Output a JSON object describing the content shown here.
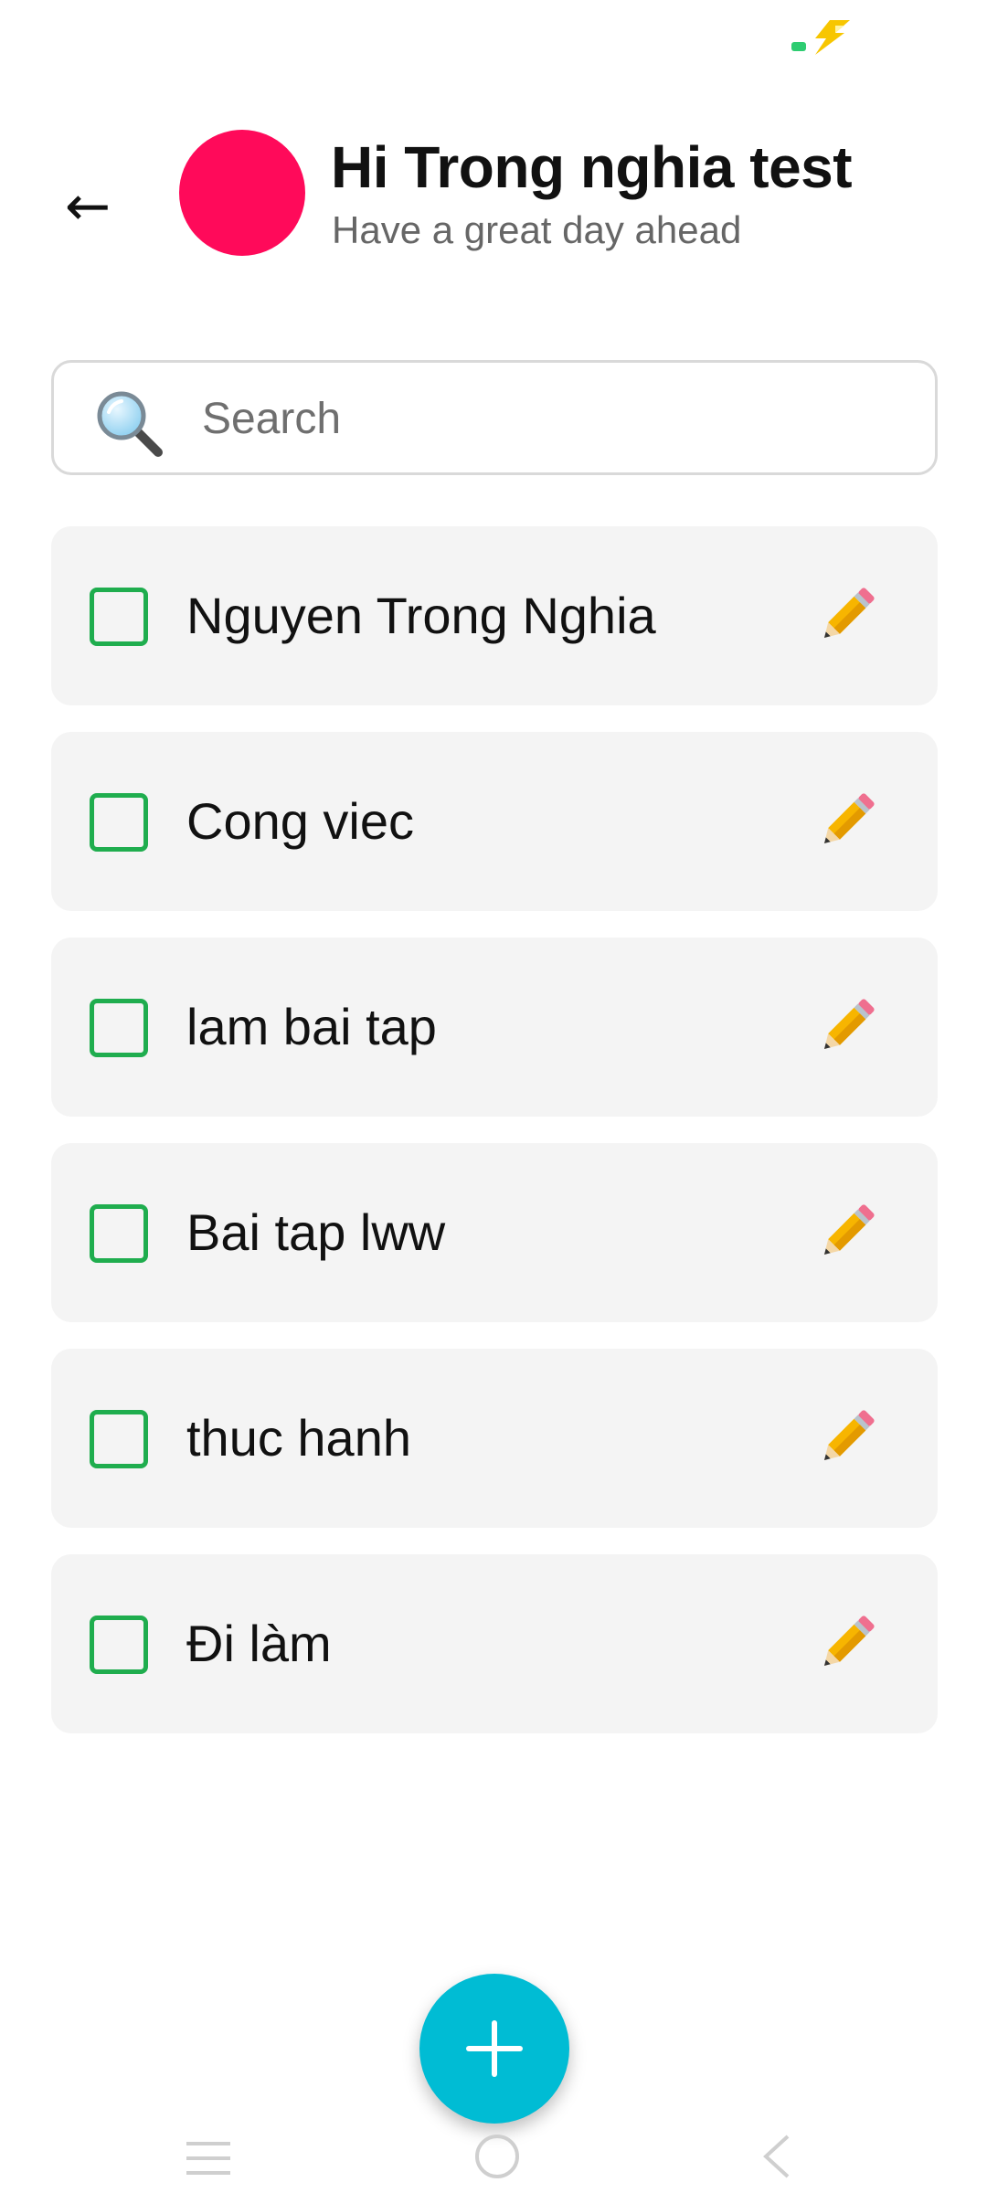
{
  "header": {
    "greeting_title": "Hi Trong nghia test",
    "greeting_subtitle": "Have a great day ahead",
    "back_icon": "arrow-left-icon",
    "back_glyph": "←",
    "avatar_color": "#ff0a5a"
  },
  "search": {
    "icon": "magnifier-icon",
    "placeholder": "Search",
    "value": ""
  },
  "todos": [
    {
      "label": "Nguyen Trong Nghia",
      "checked": false
    },
    {
      "label": "Cong viec",
      "checked": false
    },
    {
      "label": "lam bai tap",
      "checked": false
    },
    {
      "label": "Bai tap lww",
      "checked": false
    },
    {
      "label": "thuc hanh",
      "checked": false
    },
    {
      "label": "Đi làm",
      "checked": false
    }
  ],
  "item_edit_icon": "pencil-icon",
  "fab": {
    "icon": "plus-icon"
  },
  "nav": {
    "menu_icon": "menu-lines-icon",
    "home_icon": "home-circle-icon",
    "back_icon": "back-chevron-icon"
  },
  "colors": {
    "checkbox_border": "#1fad4e",
    "card_background": "#f4f4f4",
    "fab_background": "#00bcd4",
    "avatar": "#ff0a5a"
  }
}
